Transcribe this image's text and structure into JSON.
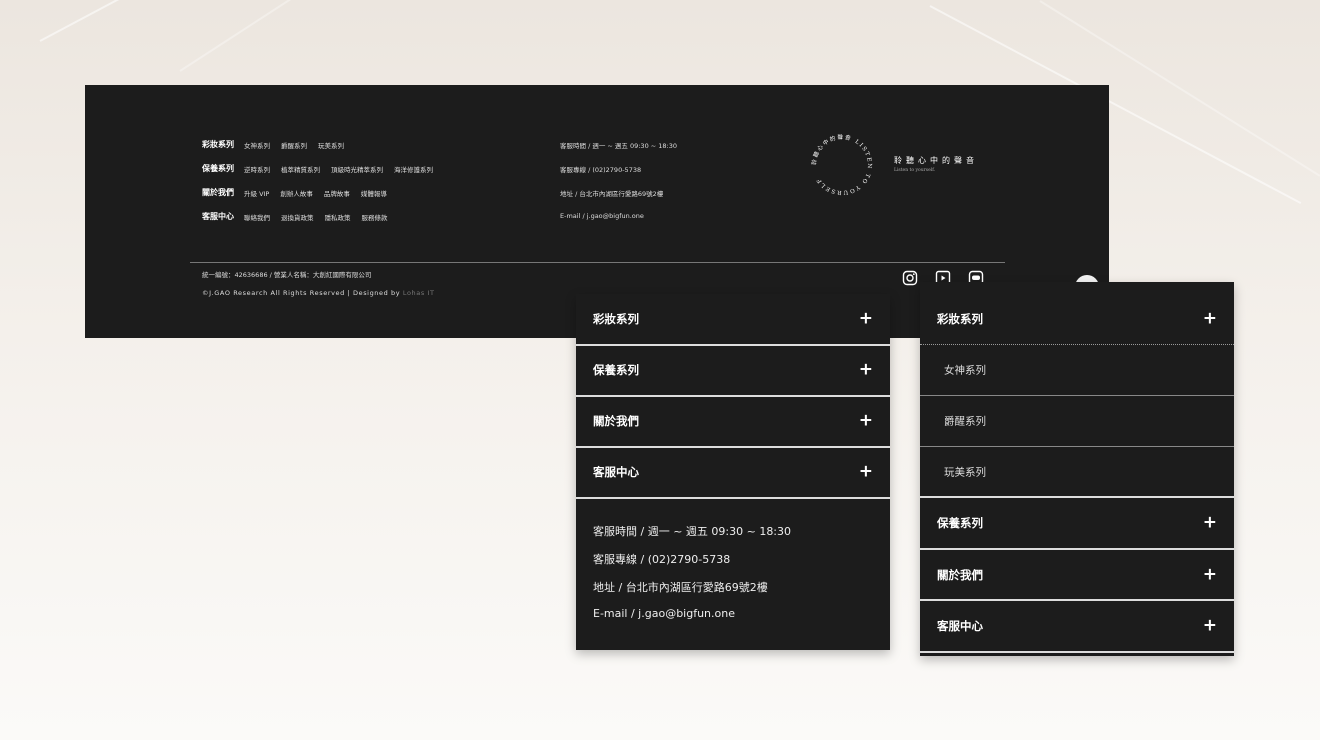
{
  "footer": {
    "nav": [
      {
        "label": "彩妝系列",
        "items": [
          "女神系列",
          "爵醒系列",
          "玩美系列"
        ]
      },
      {
        "label": "保養系列",
        "items": [
          "逆時系列",
          "植萃精質系列",
          "頂級時光精萃系列",
          "海洋修護系列"
        ]
      },
      {
        "label": "關於我們",
        "items": [
          "升級 VIP",
          "創辦人故事",
          "品牌故事",
          "媒體報導"
        ]
      },
      {
        "label": "客服中心",
        "items": [
          "聯絡我們",
          "退換貨政策",
          "隱私政策",
          "服務條款"
        ]
      }
    ],
    "info": [
      "客服時間 / 週一 ~ 週五 09:30 ~ 18:30",
      "客服專線 / (02)2790-5738",
      "地址 / 台北市內湖區行愛路69號2樓",
      "E-mail / j.gao@bigfun.one"
    ],
    "brand": {
      "title": "聆聽心中的聲音",
      "subtitle": "Listen to yourself.",
      "ring_text": "聆聽心中的聲音 LISTEN TO YOURSELF"
    },
    "legal": {
      "company": "統一編號：42636686 / 營業人名稱：大創紅國際有限公司",
      "copyright": "©J.GAO Research All Rights Reserved | Designed by",
      "designer": "Lohas IT"
    },
    "social": [
      "instagram-icon",
      "youtube-icon",
      "line-icon"
    ]
  },
  "mobile_collapsed": {
    "rows": [
      {
        "label": "彩妝系列",
        "icon": "+"
      },
      {
        "label": "保養系列",
        "icon": "+"
      },
      {
        "label": "關於我們",
        "icon": "+"
      },
      {
        "label": "客服中心",
        "icon": "+"
      }
    ],
    "contact": [
      "客服時間 / 週一 ~ 週五 09:30 ~ 18:30",
      "客服專線 / (02)2790-5738",
      "地址 / 台北市內湖區行愛路69號2樓",
      "E-mail / j.gao@bigfun.one"
    ]
  },
  "mobile_expanded": {
    "open": {
      "label": "彩妝系列",
      "icon": "+",
      "items": [
        "女神系列",
        "爵醒系列",
        "玩美系列"
      ]
    },
    "rows": [
      {
        "label": "保養系列",
        "icon": "+"
      },
      {
        "label": "關於我們",
        "icon": "+"
      },
      {
        "label": "客服中心",
        "icon": "+"
      }
    ]
  },
  "colors": {
    "panel": "#1c1c1c",
    "text": "#ffffff",
    "divider": "#dcdcdc"
  }
}
